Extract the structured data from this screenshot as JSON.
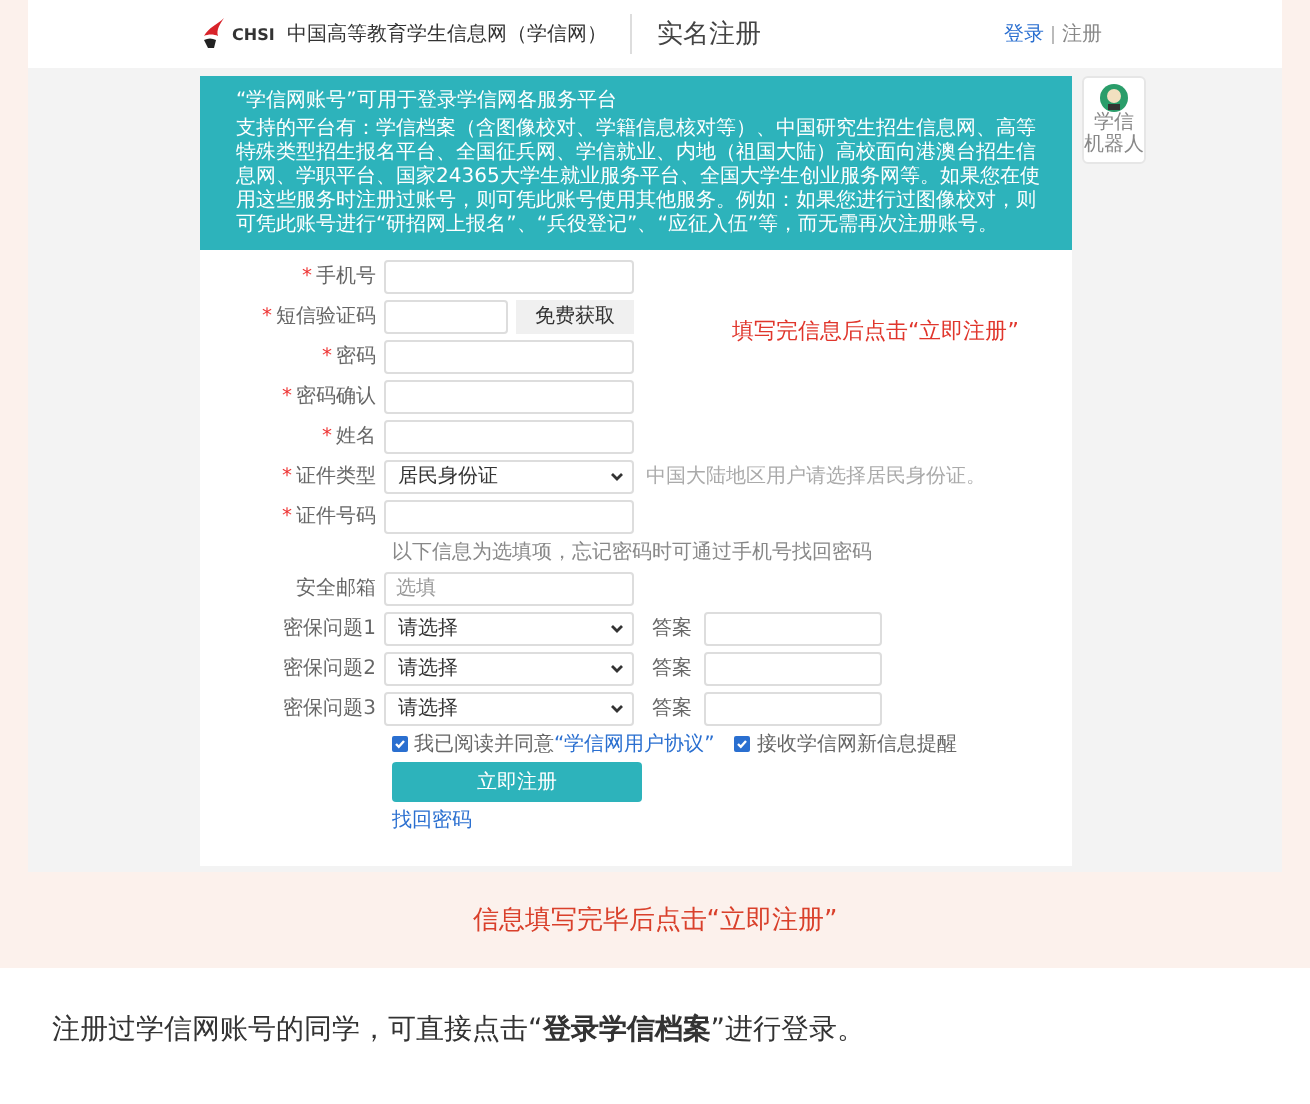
{
  "header": {
    "logo_text": "CHSI",
    "site_name": "中国高等教育学生信息网（学信网）",
    "page_title": "实名注册",
    "links": [
      {
        "label": "登录"
      },
      {
        "label": "注册"
      }
    ]
  },
  "banner": {
    "title": "“学信网账号”可用于登录学信网各服务平台",
    "description": "支持的平台有：学信档案（含图像校对、学籍信息核对等）、中国研究生招生信息网、高等特殊类型招生报名平台、全国征兵网、学信就业、内地（祖国大陆）高校面向港澳台招生信息网、学职平台、国家24365大学生就业服务平台、全国大学生创业服务网等。如果您在使用这些服务时注册过账号，则可凭此账号使用其他服务。例如：如果您进行过图像校对，则可凭此账号进行“研招网上报名”、“兵役登记”、“应征入伍”等，而无需再次注册账号。"
  },
  "side_widget": {
    "lines": [
      "学信",
      "机器人"
    ]
  },
  "form": {
    "required_mark": "*",
    "fields": [
      {
        "kind": "input",
        "label": "手机号",
        "required": true
      },
      {
        "kind": "code",
        "label": "短信验证码",
        "required": true,
        "button": "免费获取"
      },
      {
        "kind": "input",
        "label": "密码",
        "required": true
      },
      {
        "kind": "input",
        "label": "密码确认",
        "required": true
      },
      {
        "kind": "input",
        "label": "姓名",
        "required": true
      },
      {
        "kind": "select",
        "label": "证件类型",
        "required": true,
        "value": "居民身份证",
        "hint": "中国大陆地区用户请选择居民身份证。"
      },
      {
        "kind": "input",
        "label": "证件号码",
        "required": true
      },
      {
        "kind": "note",
        "text": "以下信息为选填项，忘记密码时可通过手机号找回密码"
      },
      {
        "kind": "input",
        "label": "安全邮箱",
        "required": false,
        "placeholder": "选填"
      },
      {
        "kind": "question",
        "label": "密保问题1",
        "required": false,
        "value": "请选择",
        "answer_label": "答案"
      },
      {
        "kind": "question",
        "label": "密保问题2",
        "required": false,
        "value": "请选择",
        "answer_label": "答案"
      },
      {
        "kind": "question",
        "label": "密保问题3",
        "required": false,
        "value": "请选择",
        "answer_label": "答案"
      }
    ],
    "agreements": [
      {
        "text": "我已阅读并同意",
        "link": "“学信网用户协议”",
        "checked": true
      },
      {
        "text": "接收学信网新信息提醒",
        "checked": true
      }
    ],
    "submit": "立即注册",
    "link": "找回密码"
  },
  "annotation": "填写完信息后点击“立即注册”",
  "caption": "信息填写完毕后点击“立即注册”",
  "footer": "注册过学信网账号的同学，可直接点击“**登录学信档案**”进行登录。"
}
